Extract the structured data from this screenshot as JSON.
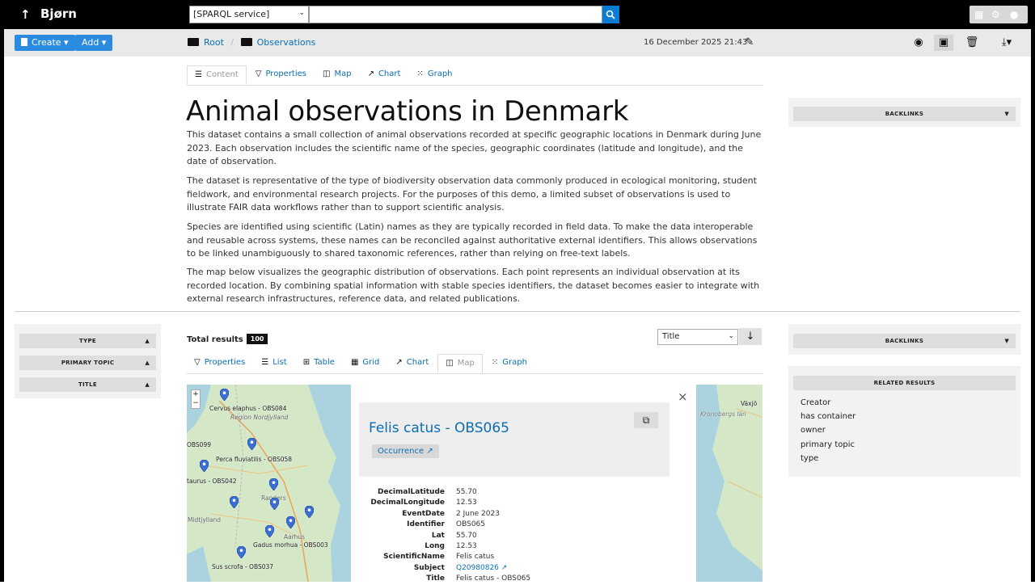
{
  "topbar": {
    "up_glyph": "↑",
    "brand": "Bjørn",
    "service_select": "[SPARQL service]",
    "search_placeholder": ""
  },
  "toolbar": {
    "create_label": "Create",
    "add_label": "Add",
    "breadcrumb": [
      "Root",
      "Observations"
    ],
    "date": "16 December 2025 21:43"
  },
  "content_tabs": [
    {
      "label": "Content",
      "icon": "document-icon",
      "active": true
    },
    {
      "label": "Properties",
      "icon": "filter-icon"
    },
    {
      "label": "Map",
      "icon": "map-icon"
    },
    {
      "label": "Chart",
      "icon": "chart-icon"
    },
    {
      "label": "Graph",
      "icon": "graph-icon"
    }
  ],
  "doc": {
    "title": "Animal observations in Denmark",
    "paragraphs": [
      "This dataset contains a small collection of animal observations recorded at specific geographic locations in Denmark during June 2023. Each observation includes the scientific name of the species, geographic coordinates (latitude and longitude), and the date of observation.",
      "The dataset is representative of the type of biodiversity observation data commonly produced in ecological monitoring, student fieldwork, and environmental research projects. For the purposes of this demo, a limited subset of observations is used to illustrate FAIR data workflows rather than to support scientific analysis.",
      "Species are identified using scientific (Latin) names as they are typically recorded in field data. To make the data interoperable and reusable across systems, these names can be reconciled against authoritative external identifiers. This allows observations to be linked unambiguously to shared taxonomic references, rather than relying on free-text labels.",
      "The map below visualizes the geographic distribution of observations. Each point represents an individual observation at its recorded location. By combining spatial information with stable species identifiers, the dataset becomes easier to integrate with external research infrastructures, reference data, and related publications."
    ]
  },
  "right_panel_top": {
    "header": "BACKLINKS"
  },
  "facets": [
    "TYPE",
    "PRIMARY TOPIC",
    "TITLE"
  ],
  "results": {
    "total_label": "Total results",
    "total": "100",
    "sort_value": "Title",
    "sort_dir_glyph": "↓",
    "tabs": [
      {
        "label": "Properties",
        "icon": "filter-icon"
      },
      {
        "label": "List",
        "icon": "list-icon"
      },
      {
        "label": "Table",
        "icon": "table-icon"
      },
      {
        "label": "Grid",
        "icon": "grid-icon"
      },
      {
        "label": "Chart",
        "icon": "chart-icon"
      },
      {
        "label": "Map",
        "icon": "map-icon",
        "active": true
      },
      {
        "label": "Graph",
        "icon": "graph-icon"
      }
    ]
  },
  "map": {
    "zoom_in": "+",
    "zoom_out": "−",
    "labels": [
      "Cervus elaphus - OBS084",
      "Region Nordjylland",
      "OBS099",
      "Perca fluviatilis - OBS058",
      "taurus - OBS042",
      "Gadus morhua - OBS003",
      "Sus scrofa - OBS037",
      "Midtjylland",
      "Aarhus",
      "Randers",
      "Växjö",
      "Kronobergs län"
    ]
  },
  "popup": {
    "title": "Felis catus - OBS065",
    "type_link": "Occurrence ↗",
    "close_glyph": "×",
    "properties": [
      {
        "key": "DecimalLatitude",
        "value": "55.70"
      },
      {
        "key": "DecimalLongitude",
        "value": "12.53"
      },
      {
        "key": "EventDate",
        "value": "2 June 2023"
      },
      {
        "key": "Identifier",
        "value": "OBS065"
      },
      {
        "key": "Lat",
        "value": "55.70"
      },
      {
        "key": "Long",
        "value": "12.53"
      },
      {
        "key": "ScientificName",
        "value": "Felis catus"
      },
      {
        "key": "Subject",
        "value": "Q20980826 ↗",
        "link": true
      },
      {
        "key": "Title",
        "value": "Felis catus - OBS065"
      }
    ]
  },
  "right_panel_bottom": {
    "backlinks_header": "BACKLINKS",
    "related_header": "RELATED RESULTS",
    "related_items": [
      "Creator",
      "has container",
      "owner",
      "primary topic",
      "type"
    ]
  },
  "colors": {
    "accent": "#0a6eb4",
    "button": "#2a8be0",
    "pin": "#3a6fd8"
  }
}
